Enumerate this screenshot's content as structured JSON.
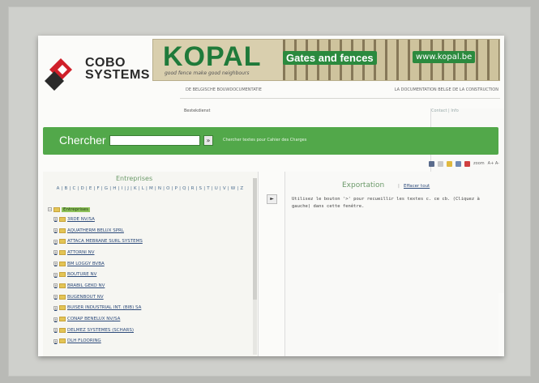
{
  "header": {
    "logo_line1": "COBO",
    "logo_line2": "SYSTEMS",
    "banner_title": "KOPAL",
    "banner_tagline": "good fence make good neighbours",
    "banner_gates": "Gates and fences",
    "banner_url": "www.kopal.be",
    "nav_left": "DE BELGISCHE BOUWDOCUMENTATIE",
    "nav_right": "LA DOCUMENTATION BELGE DE LA CONSTRUCTION",
    "subnav_left": "Bestekdienst",
    "subnav_right": "Contact | Info"
  },
  "search": {
    "label": "Chercher",
    "input_value": "",
    "button_label": "»",
    "hint": "Chercher textes pour Cahier des Charges"
  },
  "toolbar": {
    "zoom_label": "zoom",
    "size_label": "A+ A-"
  },
  "left_panel": {
    "title": "Entreprises",
    "alphabet": "A | B | C | D | E | F | G | H | I | J | K | L | M | N | O | P | Q | R | S | T | U | V | W | Z",
    "root_label": "Entreprises",
    "items": [
      "3RDE NV/SA",
      "AQUATHERM BELUX SPRL",
      "ATTACA MEBRANE SURL SYSTEMS",
      "ATTORNI NV",
      "BM LOGGY BVBA",
      "BOUTURE NV",
      "BRABIL GEKO NV",
      "BUGENBOUT NV",
      "BUISER INDUSTRIAL INT. (BIB) SA",
      "CONAP BENELUX NV/SA",
      "DELMEZ SYSTEMES (SCHARS)",
      "DLH FLOORING"
    ],
    "arrow_button": "►"
  },
  "right_panel": {
    "title": "Exportation",
    "separator": "|",
    "clear_link": "Effacer tout",
    "instructions": "Utilisez le bouton '>' pour recueillir les textes c. ce cb. (Cliquez à gauche) dans cette fenêtre."
  },
  "colors": {
    "green_bar": "#52a84a",
    "logo_red": "#d0202a",
    "kopal_green": "#1f7a3a"
  }
}
